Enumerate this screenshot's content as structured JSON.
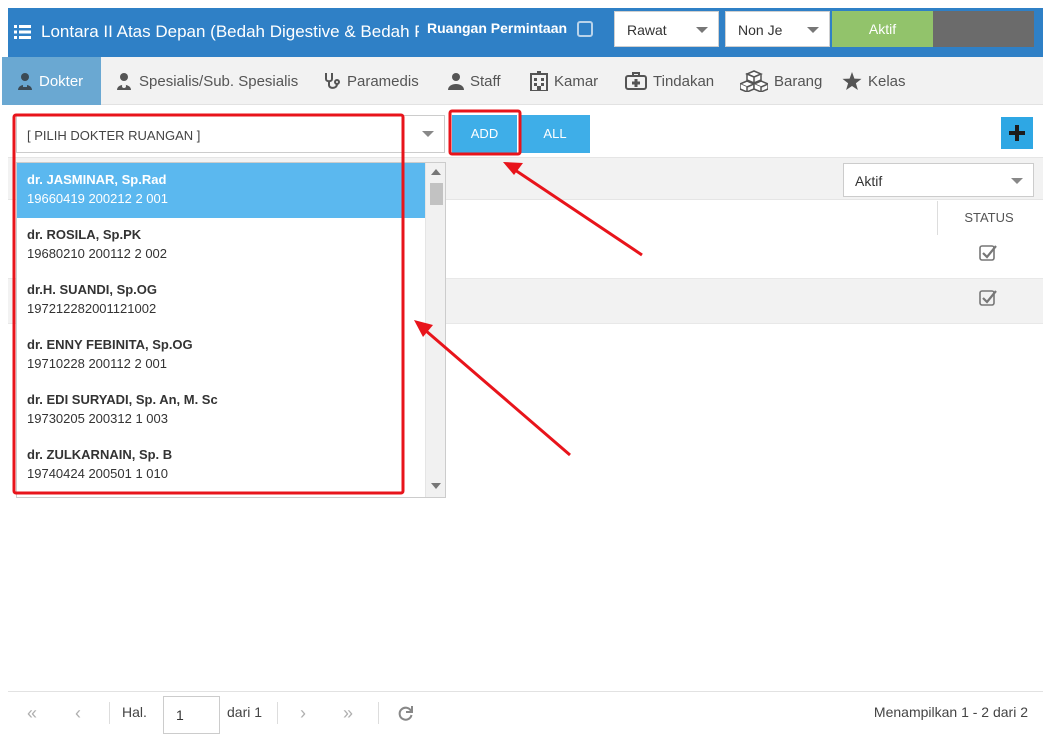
{
  "header": {
    "title": "Lontara II Atas Depan (Bedah Digestive & Bedah Pla",
    "request_label": "Ruangan Permintaan",
    "care_select": "Rawat",
    "type_select": "Non Je",
    "active_label": "Aktif",
    "brand_colors": {
      "topbar": "#2f80c6",
      "active": "#92c36b",
      "inactive": "#6b6b6b"
    }
  },
  "tabs": [
    {
      "label": "Dokter",
      "icon": "doctor-icon",
      "active": true
    },
    {
      "label": "Spesialis/Sub. Spesialis",
      "icon": "specialist-icon",
      "active": false
    },
    {
      "label": "Paramedis",
      "icon": "stethoscope-icon",
      "active": false
    },
    {
      "label": "Staff",
      "icon": "user-icon",
      "active": false
    },
    {
      "label": "Kamar",
      "icon": "hospital-icon",
      "active": false
    },
    {
      "label": "Tindakan",
      "icon": "medkit-icon",
      "active": false
    },
    {
      "label": "Barang",
      "icon": "boxes-icon",
      "active": false
    },
    {
      "label": "Kelas",
      "icon": "star-icon",
      "active": false
    }
  ],
  "toolbar": {
    "doctor_combo_placeholder": "[ PILIH DOKTER RUANGAN ]",
    "add_label": "ADD",
    "all_label": "ALL",
    "plus_icon": "plus-icon"
  },
  "grid": {
    "status_filter": "Aktif",
    "status_header": "STATUS",
    "rows": [
      {
        "status_checked": true
      },
      {
        "status_checked": true
      }
    ]
  },
  "dropdown": {
    "items": [
      {
        "name": "dr. JASMINAR, Sp.Rad",
        "nip": "19660419 200212 2 001",
        "selected": true
      },
      {
        "name": "dr. ROSILA, Sp.PK",
        "nip": "19680210 200112 2 002",
        "selected": false
      },
      {
        "name": "dr.H. SUANDI, Sp.OG",
        "nip": "197212282001121002",
        "selected": false
      },
      {
        "name": "dr. ENNY FEBINITA, Sp.OG",
        "nip": "19710228 200112 2 001",
        "selected": false
      },
      {
        "name": "dr. EDI SURYADI, Sp. An, M. Sc",
        "nip": "19730205 200312 1 003",
        "selected": false
      },
      {
        "name": "dr. ZULKARNAIN, Sp. B",
        "nip": "19740424 200501 1 010",
        "selected": false
      }
    ]
  },
  "pager": {
    "page_label": "Hal.",
    "page_value": "1",
    "of_label": "dari 1",
    "summary": "Menampilkan 1 - 2 dari 2"
  },
  "annotation_color": "#e8141b"
}
